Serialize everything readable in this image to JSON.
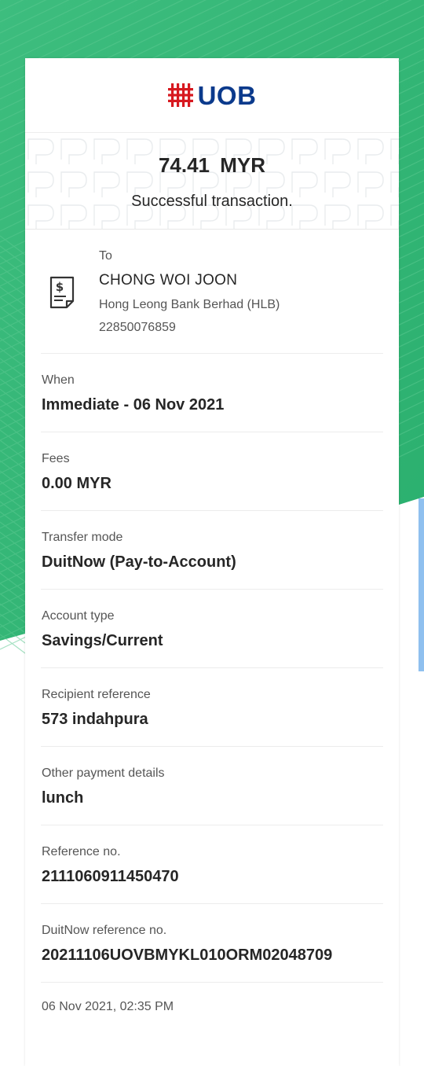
{
  "logo": {
    "text": "UOB",
    "brand_red": "#d71920",
    "brand_navy": "#0b3a8c"
  },
  "background": {
    "green": "#33b878"
  },
  "transaction": {
    "amount_line": "74.41  MYR",
    "status": "Successful transaction."
  },
  "recipient": {
    "icon": "receipt-dollar-icon",
    "label": "To",
    "name": "CHONG WOI JOON",
    "bank": "Hong Leong Bank Berhad (HLB)",
    "account": "22850076859"
  },
  "details": [
    {
      "label": "When",
      "value": "Immediate - 06 Nov 2021"
    },
    {
      "label": "Fees",
      "value": "0.00 MYR"
    },
    {
      "label": "Transfer mode",
      "value": "DuitNow (Pay-to-Account)"
    },
    {
      "label": "Account type",
      "value": "Savings/Current"
    },
    {
      "label": "Recipient reference",
      "value": "573 indahpura"
    },
    {
      "label": "Other payment details",
      "value": "lunch"
    },
    {
      "label": "Reference no.",
      "value": "2111060911450470"
    },
    {
      "label": "DuitNow reference no.",
      "value": "20211106UOVBMYKL010ORM02048709"
    }
  ],
  "timestamp": "06 Nov 2021, 02:35 PM"
}
